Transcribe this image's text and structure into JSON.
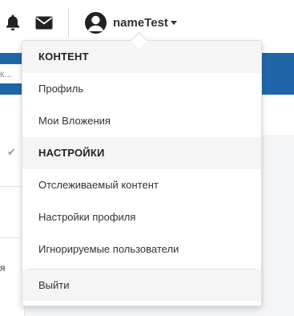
{
  "topbar": {
    "icons": {
      "notifications": "bell-icon",
      "messages": "envelope-icon",
      "avatar": "user-avatar-icon",
      "dropdown": "caret-down-icon"
    },
    "username": "nameTest"
  },
  "background": {
    "search_fragment": "к...",
    "check_icon": "check-icon",
    "fragment_char": "я"
  },
  "menu": {
    "sections": [
      {
        "header": "КОНТЕНТ",
        "items": [
          "Профиль",
          "Мои Вложения"
        ]
      },
      {
        "header": "НАСТРОЙКИ",
        "items": [
          "Отслеживаемый контент",
          "Настройки профиля",
          "Игнорируемые пользователи"
        ]
      }
    ],
    "logout_label": "Выйти"
  },
  "colors": {
    "brand_band": "#1f66a8",
    "icon_dark": "#222222",
    "menu_header_bg": "#f5f5f5"
  }
}
